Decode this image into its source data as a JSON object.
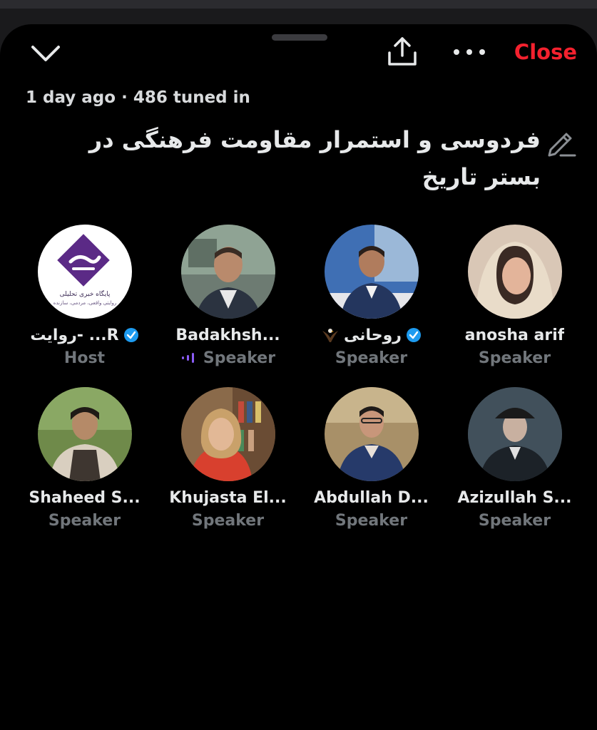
{
  "header": {
    "close_label": "Close",
    "meta": "1 day ago · 486 tuned in",
    "title": "فردوسی و استمرار مقاومت فرهنگی در بستر تاریخ"
  },
  "colors": {
    "close": "#f4212e",
    "verified": "#1d9bf0",
    "speaking": "#8b5cf6"
  },
  "participants": [
    {
      "name": "R... -روایت",
      "role": "Host",
      "verified": true,
      "avatar": "logo",
      "logo_caption": "پایگاه خبری تحلیلی",
      "logo_subcaption": "روایتی واقعی، مردمی، سازنده"
    },
    {
      "name": "Badakhsh...",
      "role": "Speaker",
      "speaking": true,
      "avatar": "photo"
    },
    {
      "name": "روحانی",
      "role": "Speaker",
      "verified": true,
      "eagle": true,
      "avatar": "photo"
    },
    {
      "name": "anosha arif",
      "role": "Speaker",
      "avatar": "photo"
    },
    {
      "name": "Shaheed S...",
      "role": "Speaker",
      "avatar": "photo"
    },
    {
      "name": "Khujasta El...",
      "role": "Speaker",
      "avatar": "photo"
    },
    {
      "name": "Abdullah D...",
      "role": "Speaker",
      "avatar": "photo"
    },
    {
      "name": "Azizullah S...",
      "role": "Speaker",
      "avatar": "photo"
    }
  ]
}
